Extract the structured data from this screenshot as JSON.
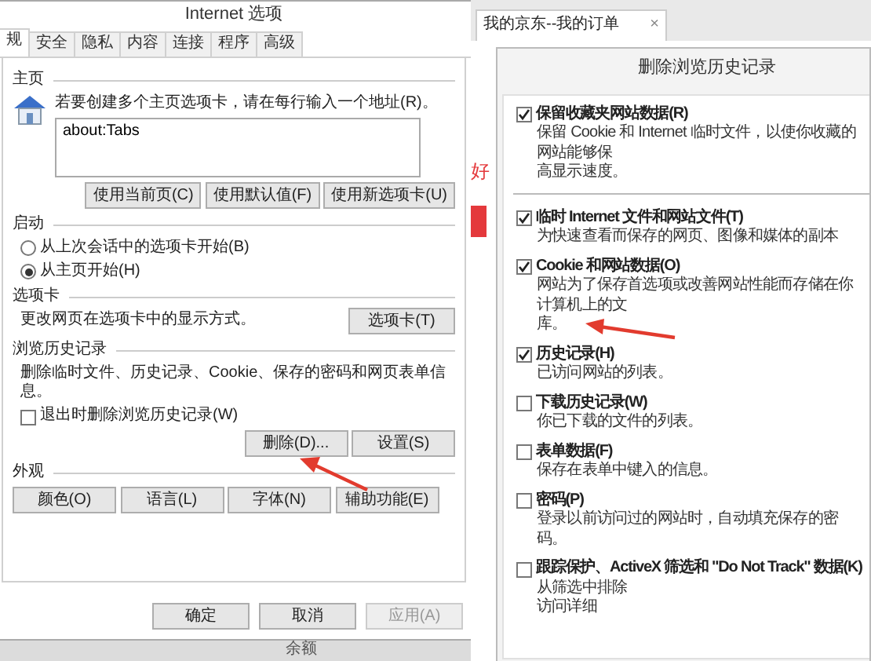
{
  "options_dialog": {
    "title": "Internet 选项",
    "tabs": [
      {
        "label": "规",
        "selected": true
      },
      {
        "label": "安全",
        "selected": false
      },
      {
        "label": "隐私",
        "selected": false
      },
      {
        "label": "内容",
        "selected": false
      },
      {
        "label": "连接",
        "selected": false
      },
      {
        "label": "程序",
        "selected": false
      },
      {
        "label": "高级",
        "selected": false
      }
    ],
    "home_page": {
      "heading": "主页",
      "hint": "若要创建多个主页选项卡，请在每行输入一个地址(R)。",
      "address": "about:Tabs",
      "buttons": [
        "使用当前页(C)",
        "使用默认值(F)",
        "使用新选项卡(U)"
      ]
    },
    "startup": {
      "heading": "启动",
      "options": [
        {
          "label": "从上次会话中的选项卡开始(B)",
          "selected": false
        },
        {
          "label": "从主页开始(H)",
          "selected": true
        }
      ]
    },
    "tabs_section": {
      "heading": "选项卡",
      "text": "更改网页在选项卡中的显示方式。",
      "button": "选项卡(T)"
    },
    "history": {
      "heading": "浏览历史记录",
      "text": "删除临时文件、历史记录、Cookie、保存的密码和网页表单信息。",
      "delete_on_exit": {
        "label": "退出时删除浏览历史记录(W)",
        "checked": false
      },
      "buttons": [
        "删除(D)...",
        "设置(S)"
      ]
    },
    "appearance": {
      "heading": "外观",
      "buttons": [
        "颜色(O)",
        "语言(L)",
        "字体(N)",
        "辅助功能(E)"
      ]
    },
    "footer_buttons": [
      {
        "label": "确定",
        "disabled": false
      },
      {
        "label": "取消",
        "disabled": false
      },
      {
        "label": "应用(A)",
        "disabled": true
      }
    ]
  },
  "browser": {
    "tab_title": "我的京东--我的订单",
    "close": "×",
    "page_text": "好",
    "status_text": "余额"
  },
  "delete_dialog": {
    "title": "删除浏览历史记录",
    "items": [
      {
        "label": "保留收藏夹网站数据(R)",
        "checked": true,
        "description": [
          "保留 Cookie 和 Internet 临时文件，以使你收藏的网站能够保",
          "高显示速度。"
        ]
      },
      {
        "label": "临时 Internet 文件和网站文件(T)",
        "checked": true,
        "description": [
          "为快速查看而保存的网页、图像和媒体的副本"
        ]
      },
      {
        "label": "Cookie 和网站数据(O)",
        "checked": true,
        "description": [
          "网站为了保存首选项或改善网站性能而存储在你计算机上的文",
          "库。"
        ]
      },
      {
        "label": "历史记录(H)",
        "checked": true,
        "description": [
          "已访问网站的列表。"
        ]
      },
      {
        "label": "下载历史记录(W)",
        "checked": false,
        "description": [
          "你已下载的文件的列表。"
        ]
      },
      {
        "label": "表单数据(F)",
        "checked": false,
        "description": [
          "保存在表单中键入的信息。"
        ]
      },
      {
        "label": "密码(P)",
        "checked": false,
        "description": [
          "登录以前访问过的网站时，自动填充保存的密码。"
        ]
      },
      {
        "label": "跟踪保护、ActiveX 筛选和 \"Do Not Track\" 数据(K)",
        "checked": false,
        "description": [
          "从筛选中排除",
          "访问详细"
        ]
      }
    ]
  }
}
